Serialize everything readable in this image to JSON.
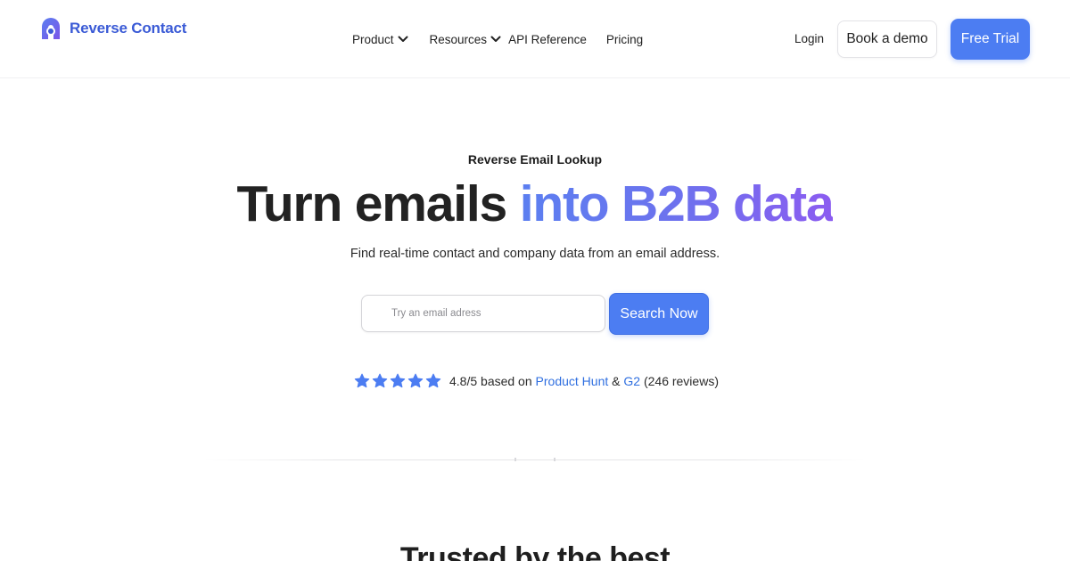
{
  "brand": {
    "name": "Reverse Contact",
    "color": "#3b5bd6"
  },
  "nav": {
    "product": "Product",
    "resources": "Resources",
    "api": "API Reference",
    "pricing": "Pricing"
  },
  "header_actions": {
    "login": "Login",
    "book_demo": "Book a demo",
    "free_trial": "Free Trial"
  },
  "hero": {
    "eyebrow": "Reverse Email Lookup",
    "headline_plain": "Turn emails ",
    "headline_accent": "into B2B data",
    "subline": "Find real-time contact and company data from an email address."
  },
  "search": {
    "placeholder": "Try an email adress",
    "value": "",
    "button": "Search Now"
  },
  "rating": {
    "stars": 5,
    "score": "4.8/5 based on",
    "source1": "Product Hunt",
    "amp": "&",
    "source2": "G2",
    "count": "(246 reviews)"
  },
  "next_section": {
    "heading": "Trusted by the best"
  },
  "colors": {
    "accent": "#4c7df2",
    "link": "#2f6fe0",
    "gradient_start": "#5b7ff0",
    "gradient_end": "#8b5cf0"
  },
  "icons": {
    "logo": "reverse-contact-logo-icon",
    "chevron": "chevron-down-icon",
    "star": "star-icon"
  }
}
